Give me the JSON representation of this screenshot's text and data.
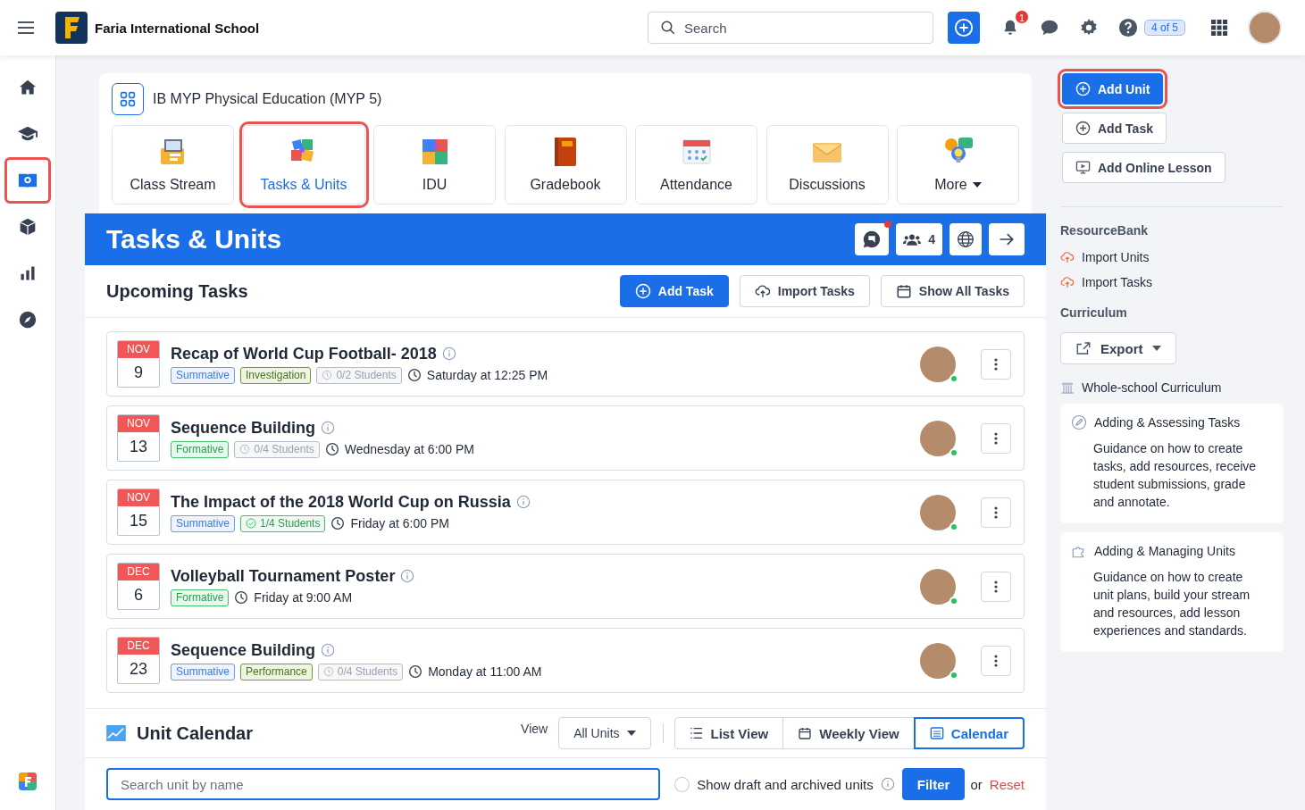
{
  "topbar": {
    "school_name": "Faria International School",
    "search_placeholder": "Search",
    "notification_count": "1",
    "help_progress": "4 of 5"
  },
  "sidebar": {
    "items": [
      {
        "kind": "home",
        "selected": false,
        "highlighted": false
      },
      {
        "kind": "classes",
        "selected": false,
        "highlighted": false
      },
      {
        "kind": "course",
        "selected": true,
        "highlighted": true
      },
      {
        "kind": "package",
        "selected": false,
        "highlighted": false
      },
      {
        "kind": "reports",
        "selected": false,
        "highlighted": false
      },
      {
        "kind": "explore",
        "selected": false,
        "highlighted": false
      }
    ]
  },
  "course": {
    "title": "IB MYP Physical Education (MYP 5)",
    "tabs": [
      {
        "label": "Class Stream",
        "kind": "stream",
        "selected": false,
        "highlighted": false
      },
      {
        "label": "Tasks & Units",
        "kind": "tasks",
        "selected": true,
        "highlighted": true
      },
      {
        "label": "IDU",
        "kind": "idu",
        "selected": false,
        "highlighted": false
      },
      {
        "label": "Gradebook",
        "kind": "gradebook",
        "selected": false,
        "highlighted": false
      },
      {
        "label": "Attendance",
        "kind": "attendance",
        "selected": false,
        "highlighted": false
      },
      {
        "label": "Discussions",
        "kind": "discussions",
        "selected": false,
        "highlighted": false
      },
      {
        "label": "More",
        "kind": "more",
        "selected": false,
        "highlighted": false
      }
    ]
  },
  "header": {
    "title": "Tasks & Units",
    "chat_unread": true,
    "member_count": "4"
  },
  "upcoming": {
    "title": "Upcoming Tasks",
    "buttons": [
      {
        "label": "Add Task",
        "kind": "add"
      },
      {
        "label": "Import Tasks",
        "kind": "import"
      },
      {
        "label": "Show All Tasks",
        "kind": "calendar"
      }
    ]
  },
  "tasks": [
    {
      "month": "NOV",
      "day": "9",
      "title": "Recap of World Cup Football- 2018",
      "tags": [
        {
          "label": "Summative",
          "kind": "summative"
        },
        {
          "label": "Investigation",
          "kind": "criterion"
        },
        {
          "label": "0/2 Students",
          "kind": "pending"
        }
      ],
      "due": "Saturday at 12:25 PM",
      "online": true
    },
    {
      "month": "NOV",
      "day": "13",
      "title": "Sequence Building",
      "tags": [
        {
          "label": "Formative",
          "kind": "formative"
        },
        {
          "label": "0/4 Students",
          "kind": "pending"
        }
      ],
      "due": "Wednesday at 6:00 PM",
      "online": true
    },
    {
      "month": "NOV",
      "day": "15",
      "title": "The Impact of the 2018 World Cup on Russia",
      "tags": [
        {
          "label": "Summative",
          "kind": "summative"
        },
        {
          "label": "1/4 Students",
          "kind": "done"
        }
      ],
      "due": "Friday at 6:00 PM",
      "online": true
    },
    {
      "month": "DEC",
      "day": "6",
      "title": "Volleyball Tournament Poster",
      "tags": [
        {
          "label": "Formative",
          "kind": "formative"
        }
      ],
      "due": "Friday at 9:00 AM",
      "online": true
    },
    {
      "month": "DEC",
      "day": "23",
      "title": "Sequence Building",
      "tags": [
        {
          "label": "Summative",
          "kind": "summative"
        },
        {
          "label": "Performance",
          "kind": "criterion"
        },
        {
          "label": "0/4 Students",
          "kind": "pending"
        }
      ],
      "due": "Monday at 11:00 AM",
      "online": true
    }
  ],
  "unit_calendar": {
    "title": "Unit Calendar",
    "view_label": "View",
    "view_select": "All Units",
    "views": [
      {
        "label": "List View",
        "kind": "list",
        "selected": false
      },
      {
        "label": "Weekly View",
        "kind": "week",
        "selected": false
      },
      {
        "label": "Calendar",
        "kind": "calendar",
        "selected": true
      }
    ],
    "search_placeholder": "Search unit by name",
    "show_draft_label": "Show draft and archived units",
    "show_draft_checked": false,
    "filter_label": "Filter",
    "or_text": "or",
    "reset_label": "Reset"
  },
  "actions": [
    {
      "label": "Add Unit",
      "kind": "primary",
      "highlighted": true
    },
    {
      "label": "Add Task",
      "kind": "add",
      "highlighted": false
    },
    {
      "label": "Add Online Lesson",
      "kind": "lesson",
      "highlighted": false
    }
  ],
  "resource_bank": {
    "title": "ResourceBank",
    "links": [
      "Import Units",
      "Import Tasks"
    ]
  },
  "curriculum": {
    "title": "Curriculum",
    "export_label": "Export",
    "whole_school": "Whole-school Curriculum"
  },
  "guides": [
    {
      "title": "Adding & Assessing Tasks",
      "kind": "tasks",
      "text": "Guidance on how to create tasks, add resources, receive student submissions, grade and annotate."
    },
    {
      "title": "Adding & Managing Units",
      "kind": "units",
      "text": "Guidance on how to create unit plans, build your stream and resources, add lesson experiences and standards."
    }
  ]
}
